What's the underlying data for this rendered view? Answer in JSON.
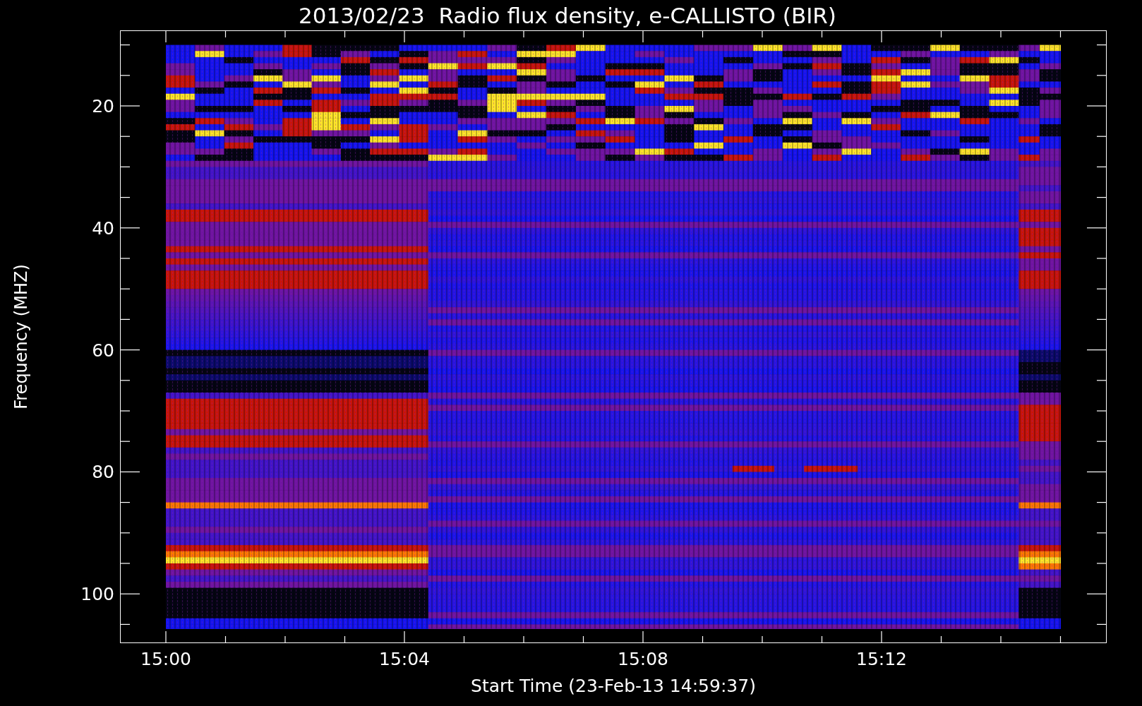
{
  "title": "2013/02/23  Radio flux density, e-CALLISTO (BIR)",
  "y_axis": {
    "label": "Frequency (MHZ)",
    "ticks": [
      "20",
      "40",
      "60",
      "80",
      "100"
    ]
  },
  "x_axis": {
    "label": "Start Time (23-Feb-13 14:59:37)",
    "ticks": [
      "15:00",
      "15:04",
      "15:08",
      "15:12"
    ]
  }
}
